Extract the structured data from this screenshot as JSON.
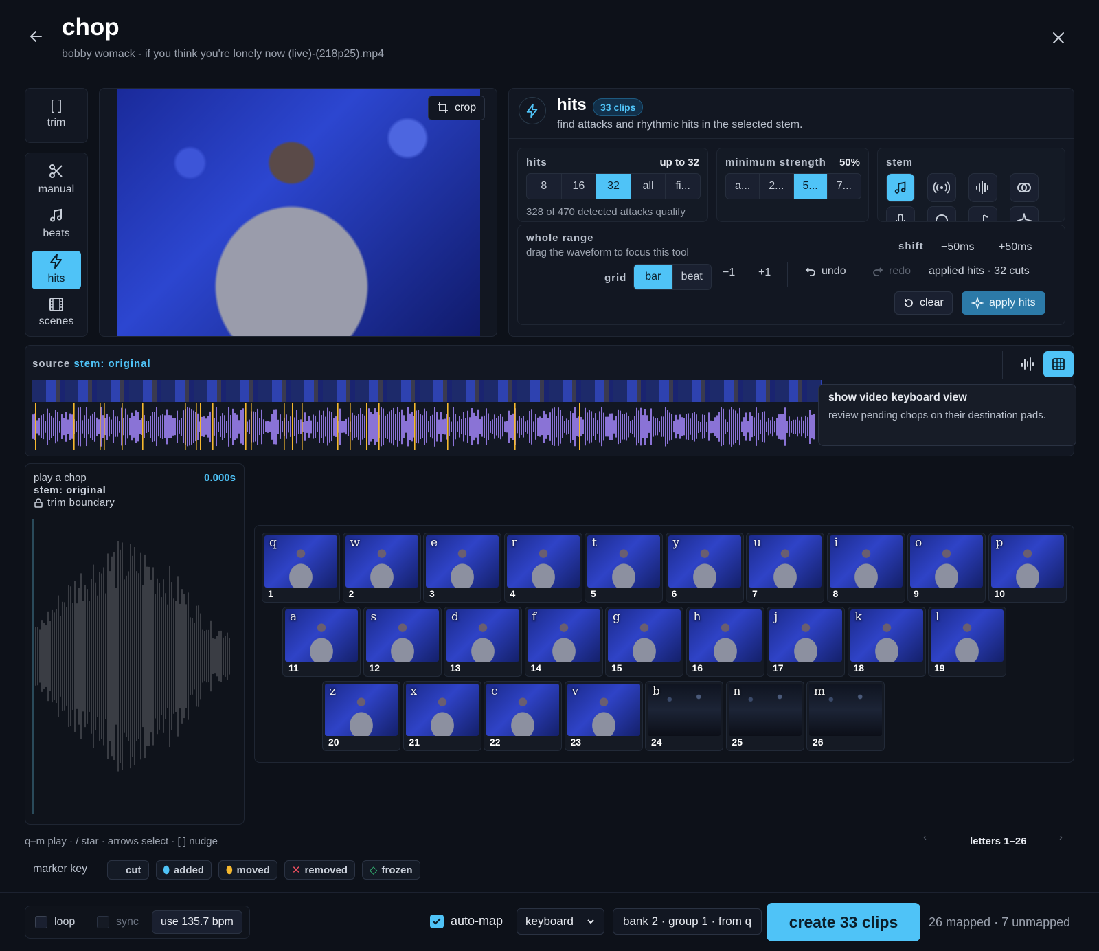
{
  "header": {
    "title": "chop",
    "subtitle": "bobby womack - if you think you're lonely now (live)-(218p25).mp4"
  },
  "tools": [
    {
      "label": "trim",
      "icon": "brackets-icon"
    },
    {
      "label": "manual",
      "icon": "scissors-icon"
    },
    {
      "label": "beats",
      "icon": "music-note-icon"
    },
    {
      "label": "hits",
      "icon": "lightning-icon"
    },
    {
      "label": "scenes",
      "icon": "film-icon"
    }
  ],
  "video": {
    "crop_label": "crop"
  },
  "hits_panel": {
    "title": "hits",
    "badge": "33 clips",
    "description": "find attacks and rhythmic hits in the selected stem.",
    "hits": {
      "label": "hits",
      "value": "up to 32",
      "options": [
        "8",
        "16",
        "32",
        "all",
        "fi..."
      ],
      "selected": "32",
      "note": "328 of 470 detected attacks qualify"
    },
    "strength": {
      "label": "minimum strength",
      "value": "50%",
      "options": [
        "a...",
        "2...",
        "5...",
        "7..."
      ],
      "selected": "5..."
    },
    "stem": {
      "label": "stem",
      "icons": [
        "music-notes-icon",
        "broadcast-icon",
        "waveform-icon",
        "link-icon",
        "microphone-icon",
        "circle-icon",
        "single-note-icon",
        "sparkle-icon"
      ]
    },
    "range": {
      "title": "whole range",
      "hint": "drag the waveform to focus this tool",
      "shift_label": "shift",
      "shift_minus": "−50ms",
      "shift_plus": "+50ms",
      "grid_label": "grid",
      "grid_options": [
        "bar",
        "beat"
      ],
      "grid_selected": "bar",
      "minus_one": "−1",
      "plus_one": "+1",
      "undo": "undo",
      "redo": "redo",
      "applied": "applied hits · 32 cuts",
      "clear": "clear",
      "apply": "apply hits"
    }
  },
  "source": {
    "label": "source",
    "stem": "stem: original",
    "tooltip_title": "show video keyboard view",
    "tooltip_body": "review pending chops on their destination pads."
  },
  "preview": {
    "title": "play a chop",
    "time": "0.000s",
    "stem": "stem: original",
    "trim": "trim boundary"
  },
  "pads": {
    "row1": [
      {
        "key": "q",
        "num": "1"
      },
      {
        "key": "w",
        "num": "2"
      },
      {
        "key": "e",
        "num": "3"
      },
      {
        "key": "r",
        "num": "4"
      },
      {
        "key": "t",
        "num": "5"
      },
      {
        "key": "y",
        "num": "6"
      },
      {
        "key": "u",
        "num": "7"
      },
      {
        "key": "i",
        "num": "8"
      },
      {
        "key": "o",
        "num": "9"
      },
      {
        "key": "p",
        "num": "10"
      }
    ],
    "row2": [
      {
        "key": "a",
        "num": "11"
      },
      {
        "key": "s",
        "num": "12"
      },
      {
        "key": "d",
        "num": "13"
      },
      {
        "key": "f",
        "num": "14"
      },
      {
        "key": "g",
        "num": "15"
      },
      {
        "key": "h",
        "num": "16"
      },
      {
        "key": "j",
        "num": "17"
      },
      {
        "key": "k",
        "num": "18"
      },
      {
        "key": "l",
        "num": "19"
      }
    ],
    "row3": [
      {
        "key": "z",
        "num": "20"
      },
      {
        "key": "x",
        "num": "21"
      },
      {
        "key": "c",
        "num": "22"
      },
      {
        "key": "v",
        "num": "23"
      },
      {
        "key": "b",
        "num": "24"
      },
      {
        "key": "n",
        "num": "25"
      },
      {
        "key": "m",
        "num": "26"
      }
    ]
  },
  "footer": {
    "shortcuts": "q–m play · / star · arrows select · [ ] nudge",
    "page_label": "letters 1–26",
    "marker_key": "marker key",
    "markers": [
      "cut",
      "added",
      "moved",
      "removed",
      "frozen"
    ],
    "loop": "loop",
    "sync": "sync",
    "bpm": "use 135.7 bpm",
    "automap": "auto-map",
    "mode": "keyboard",
    "bank": "bank 2 · group 1 · from q",
    "create": "create 33 clips",
    "status": "26 mapped · 7 unmapped"
  }
}
